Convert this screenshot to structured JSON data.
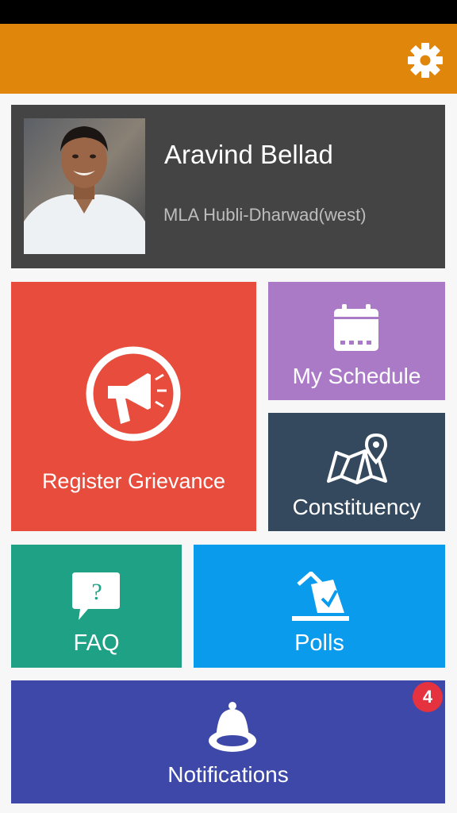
{
  "header": {
    "settings_icon": "gear-icon",
    "bar_color": "#e0870b"
  },
  "profile": {
    "name": "Aravind Bellad",
    "role": "MLA Hubli-Dharwad(west)"
  },
  "tiles": {
    "grievance": {
      "label": "Register Grievance",
      "icon": "megaphone-icon",
      "color": "#e74c3c"
    },
    "schedule": {
      "label": "My Schedule",
      "icon": "calendar-icon",
      "color": "#ab7ac7"
    },
    "constituency": {
      "label": "Constituency",
      "icon": "map-icon",
      "color": "#34495e"
    },
    "faq": {
      "label": "FAQ",
      "icon": "question-bubble-icon",
      "color": "#1ea184"
    },
    "polls": {
      "label": "Polls",
      "icon": "ballot-box-icon",
      "color": "#0b9bed"
    },
    "notifications": {
      "label": "Notifications",
      "icon": "bell-icon",
      "color": "#3d48a8",
      "badge": "4"
    }
  }
}
